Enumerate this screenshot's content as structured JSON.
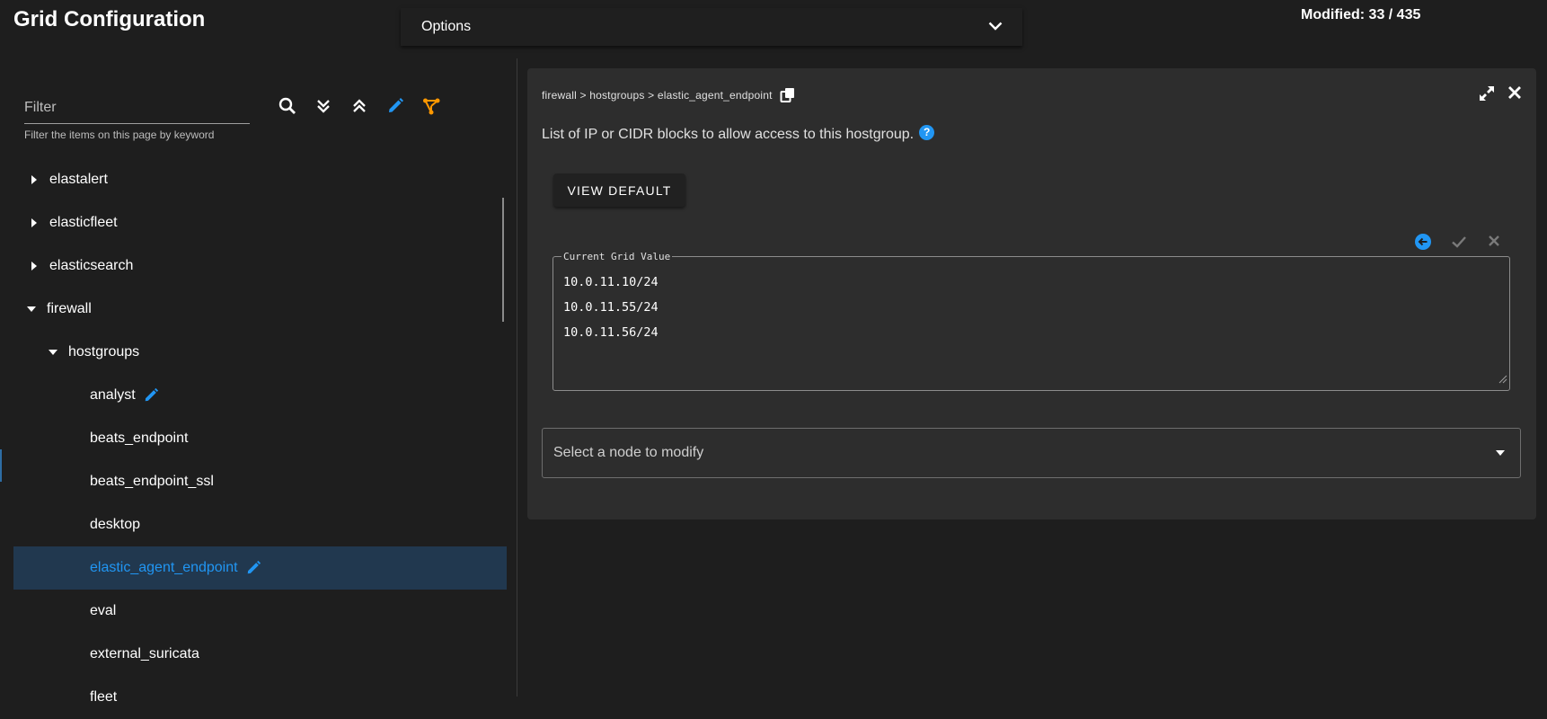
{
  "header": {
    "title": "Grid Configuration",
    "options_label": "Options",
    "modified": "Modified: 33 / 435"
  },
  "filter": {
    "placeholder": "Filter",
    "hint": "Filter the items on this page by keyword"
  },
  "toolbar_icons": [
    "search-icon",
    "expand-all-icon",
    "collapse-all-icon",
    "edit-pencil-icon",
    "advanced-icon"
  ],
  "tree": {
    "items": [
      {
        "label": "elastalert",
        "state": "collapsed"
      },
      {
        "label": "elasticfleet",
        "state": "collapsed"
      },
      {
        "label": "elasticsearch",
        "state": "collapsed"
      },
      {
        "label": "firewall",
        "state": "expanded"
      },
      {
        "label": "hostgroups",
        "state": "expanded"
      },
      {
        "label": "analyst",
        "modified": true
      },
      {
        "label": "beats_endpoint"
      },
      {
        "label": "beats_endpoint_ssl"
      },
      {
        "label": "desktop"
      },
      {
        "label": "elastic_agent_endpoint",
        "modified": true,
        "selected": true
      },
      {
        "label": "eval"
      },
      {
        "label": "external_suricata"
      },
      {
        "label": "fleet"
      }
    ]
  },
  "detail": {
    "breadcrumb": "firewall > hostgroups > elastic_agent_endpoint",
    "description": "List of IP or CIDR blocks to allow access to this hostgroup.",
    "help": "?",
    "view_default_label": "VIEW DEFAULT",
    "current_value_label": "Current Grid Value",
    "current_value": "10.0.11.10/24\n10.0.11.55/24\n10.0.11.56/24",
    "node_select_placeholder": "Select a node to modify"
  },
  "colors": {
    "accent_blue": "#2196f3",
    "accent_orange": "#ff9800",
    "selected_row_bg": "#21384f",
    "card_bg": "#2d2d2d",
    "page_bg": "#1e1e1e"
  }
}
